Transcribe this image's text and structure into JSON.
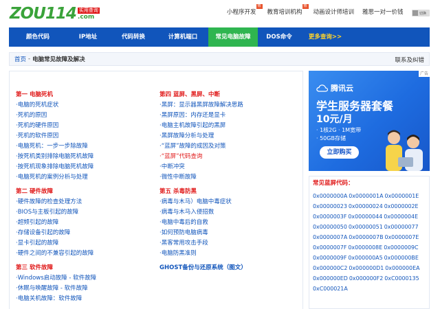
{
  "logo": {
    "main": "ZOU114",
    "sub": "实用查询",
    "com": ".com"
  },
  "topnav": [
    {
      "label": "小程序开发",
      "hot": "热"
    },
    {
      "label": "教育培训机构",
      "hot": "热"
    },
    {
      "label": "动画设计师培训",
      "hot": ""
    },
    {
      "label": "雅思一对一价钱",
      "hot": ""
    }
  ],
  "toggle_label": "切换",
  "mainnav": [
    {
      "label": "颜色代码",
      "active": false
    },
    {
      "label": "IP地址",
      "active": false
    },
    {
      "label": "代码转换",
      "active": false
    },
    {
      "label": "计算机端口",
      "active": false
    },
    {
      "label": "常见电脑故障",
      "active": true
    },
    {
      "label": "DOS命令",
      "active": false
    },
    {
      "label": "更多查询>>",
      "active": false
    }
  ],
  "breadcrumb": {
    "home": "首页",
    "sep": "-",
    "current": "电脑常见故障及解决",
    "feedback": "联系及纠错"
  },
  "left_sections": [
    {
      "title": "第一 电脑死机",
      "links": [
        "·电脑的死机症状",
        "·死机的原因",
        "·死机的硬件原因",
        "·死机的软件原因",
        "·电脑死机：一步一步除故障",
        "·按死机类别排除电脑死机故障",
        "·按死机现象排除电脑死机故障",
        "·电脑死机的案例分析与处理"
      ]
    },
    {
      "title": "第二 硬件故障",
      "links": [
        "·硬件故障的检查处理方法",
        "·BIOS与主板引起的故障",
        "·超频引起的故障",
        "·存储设备引起的故障",
        "·显卡引起的故障",
        "·硬件之间的不兼容引起的故障"
      ]
    },
    {
      "title": "第三 软件故障",
      "links": [
        "·Windows启动故障 - 软件故障",
        "·休眠与唤醒故障 - 软件故障",
        "·电脑关机故障：软件故障"
      ]
    }
  ],
  "right_sections": [
    {
      "title": "第四 蓝屏、黑屏、中断",
      "links": [
        "·黑屏：显示器黑屏故障解决思路",
        "·黑屏原因：内存还是显卡",
        "·电脑主机故障引起的黑屏",
        "·黑屏故障分析与处理",
        "·“蓝屏”故障的成因及对策",
        "·“蓝屏”代码查询",
        "·中断冲突",
        "·微性中断故障"
      ],
      "red_index": 5
    },
    {
      "title": "第五 杀毒防黑",
      "links": [
        "·病毒与木马）电脑中毒症状",
        "·病毒与木马入侵招数",
        "·电脑中毒后的自救",
        "·如何预防电脑病毒",
        "·黑客常用攻击手段",
        "·电脑防黑准则"
      ],
      "red_index": -1
    }
  ],
  "ghost_title": "GHOST备份与还原系统（图文）",
  "ad": {
    "tag": "广告",
    "brand": "腾讯云",
    "headline": "学生服务器套餐",
    "price": "10元/月",
    "spec1": "· 1核2G  · 1M宽带",
    "spec2": "· 50GB存储",
    "button": "立即购买"
  },
  "codes": {
    "title": "常见蓝屏代码：",
    "items": [
      "0x0000000A",
      "0x0000001A",
      "0x0000001E",
      "0x00000023",
      "0x00000024",
      "0x0000002E",
      "0x0000003F",
      "0x00000044",
      "0x0000004E",
      "0x00000050",
      "0x00000051",
      "0x00000077",
      "0x0000007A",
      "0x0000007B",
      "0x0000007E",
      "0x0000007F",
      "0x0000008E",
      "0x0000009C",
      "0x0000009F",
      "0x000000A5",
      "0x000000BE",
      "0x000000C2",
      "0x000000D1",
      "0x000000EA",
      "0x000000ED",
      "0x000000F2",
      "0xC0000135",
      "0xC000021A"
    ]
  },
  "colors": {
    "nav_blue": "#1155bb",
    "active_green": "#2fb550",
    "title_red": "#e01a1a",
    "link_blue": "#1155bb"
  }
}
